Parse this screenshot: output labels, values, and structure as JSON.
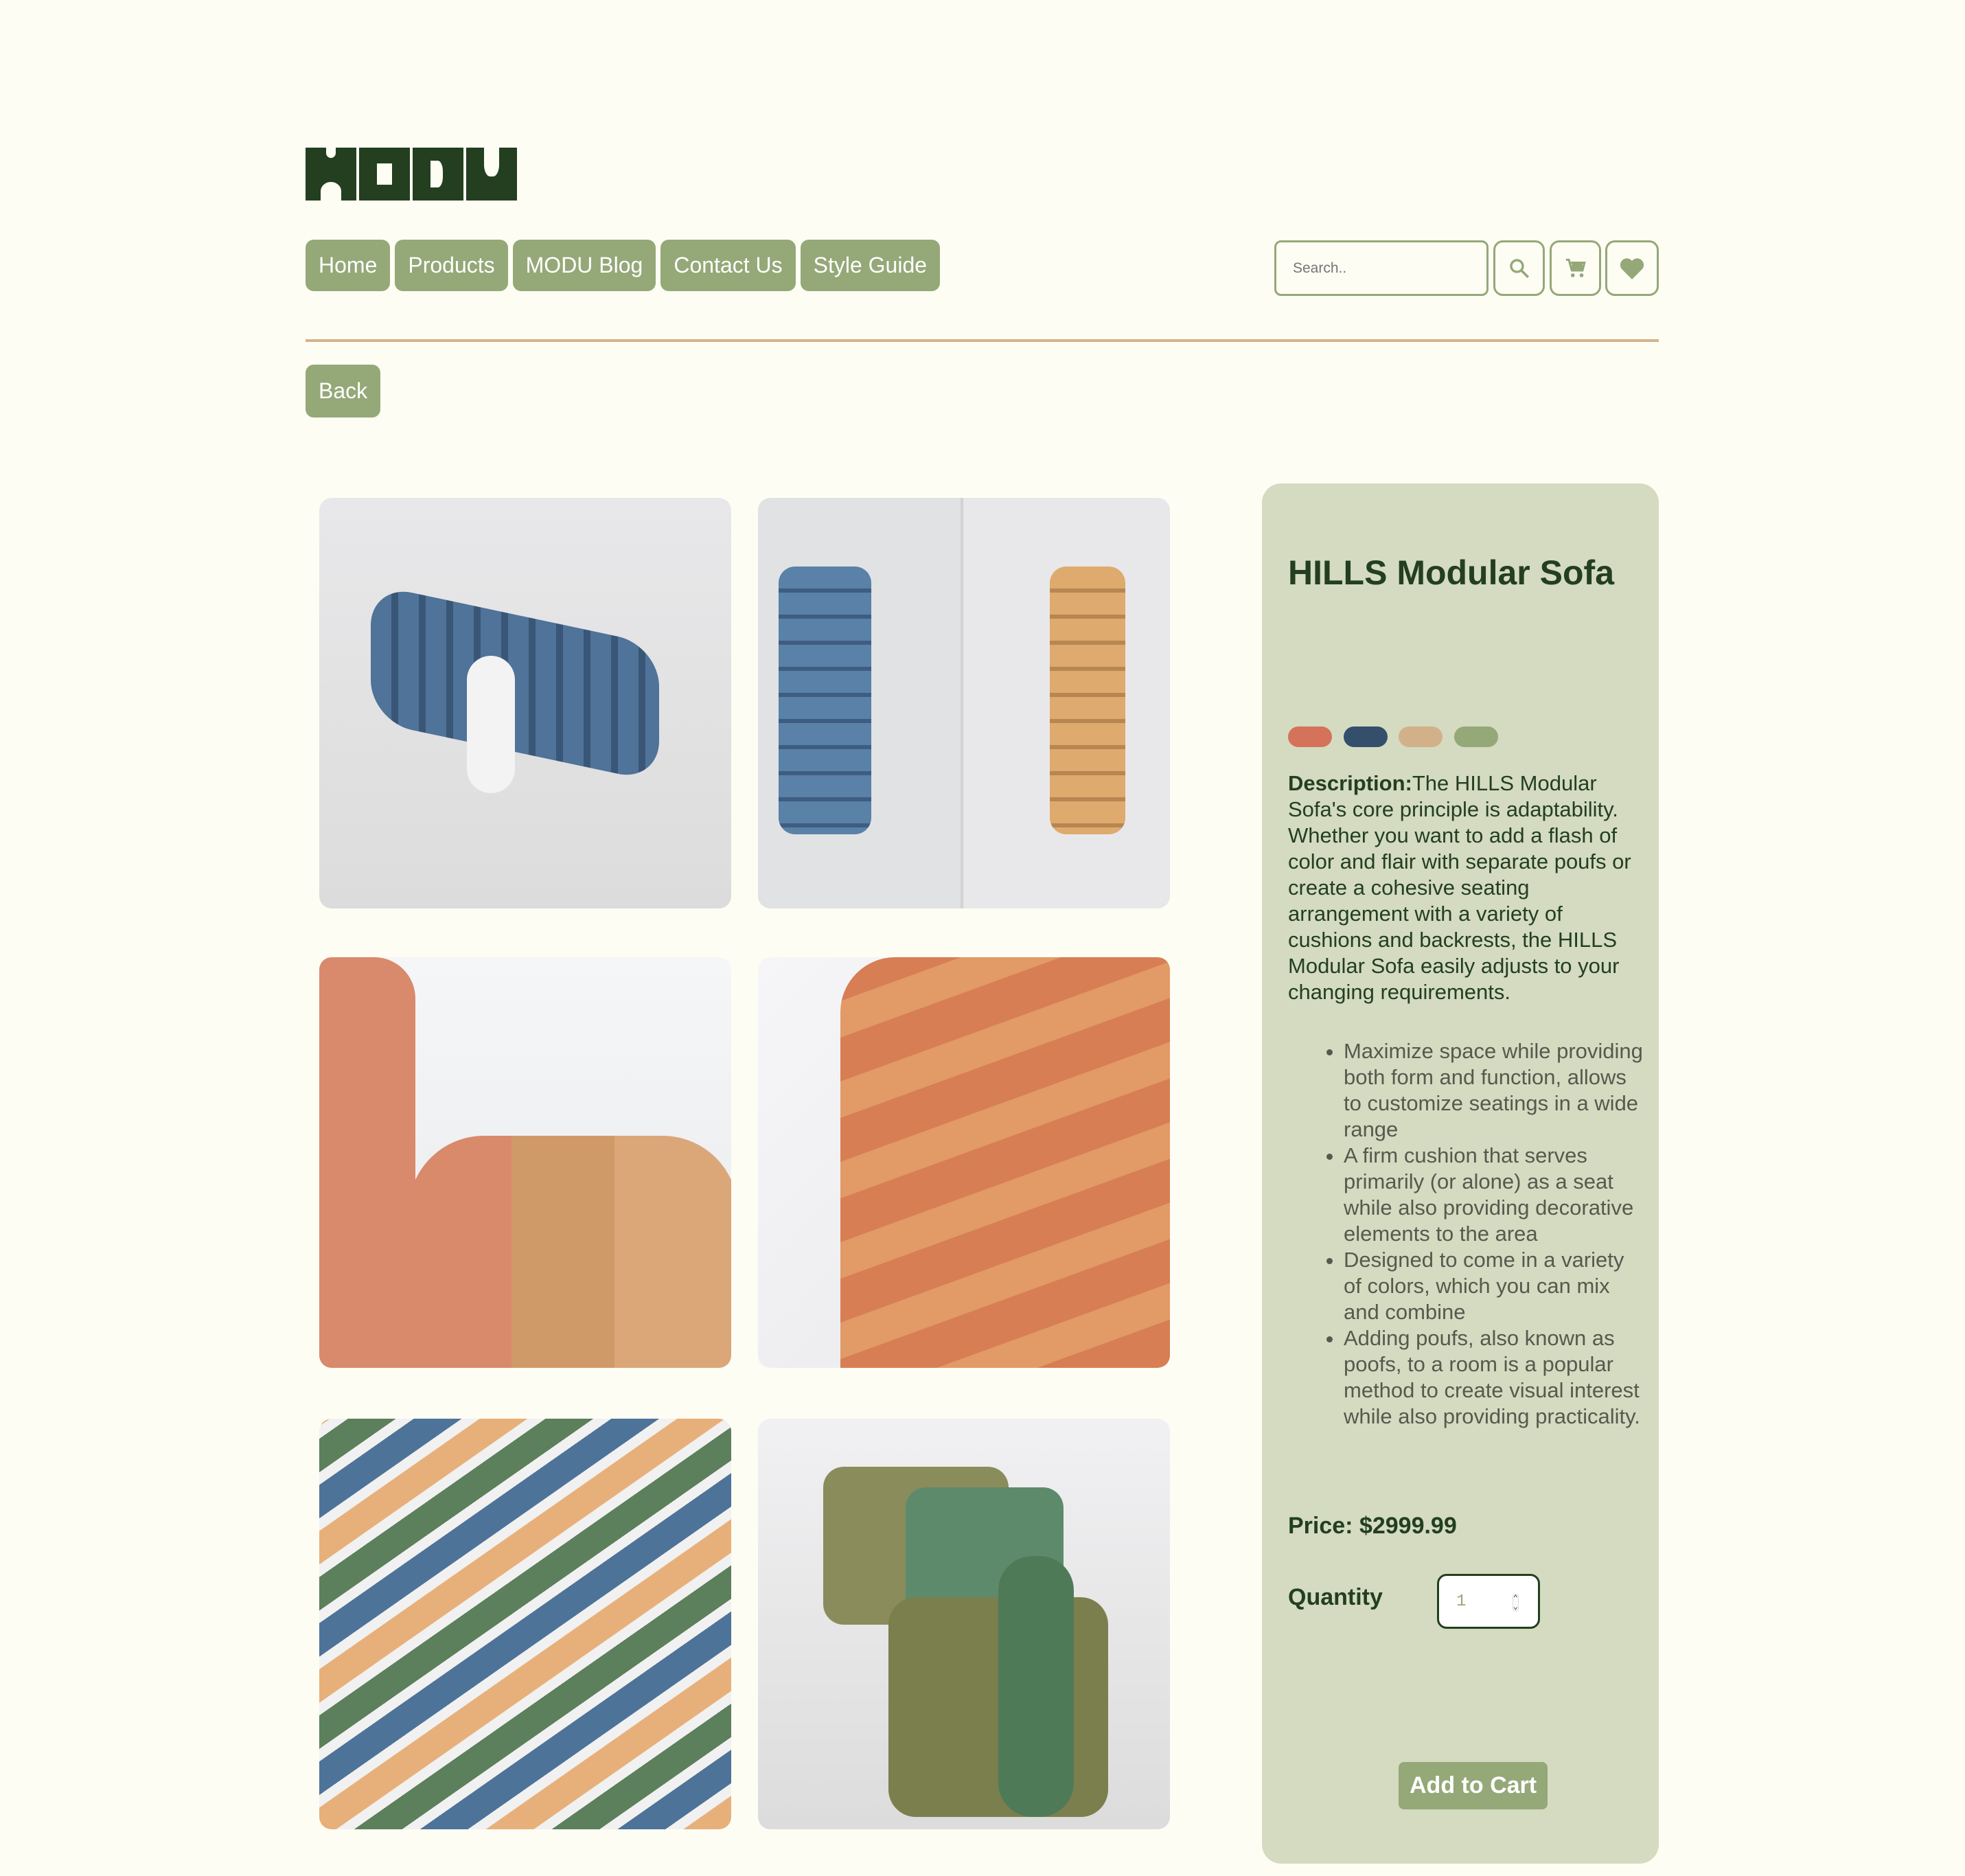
{
  "brand": {
    "logo_text": "MODU"
  },
  "nav": {
    "items": [
      "Home",
      "Products",
      "MODU Blog",
      "Contact Us",
      "Style Guide"
    ]
  },
  "search": {
    "placeholder": "Search.."
  },
  "icons": {
    "search": "search-icon",
    "cart": "cart-icon",
    "wishlist": "heart-icon"
  },
  "back_label": "Back",
  "product": {
    "title": "HILLS Modular Sofa",
    "colors": [
      "#d4735a",
      "#334f6c",
      "#d2b18a",
      "#95a878"
    ],
    "description_label": "Description:",
    "description": "The HILLS Modular Sofa's core principle is adaptability. Whether you want to add a flash of color and flair with separate poufs or create a cohesive seating arrangement with a variety of cushions and backrests, the HILLS Modular Sofa easily adjusts to your changing requirements.",
    "features": [
      "Maximize space while providing both form and function, allows to customize seatings in a wide range",
      "A firm cushion that serves primarily (or alone) as a seat while also providing decorative elements to the area",
      "Designed to come in a variety of colors, which you can mix and combine",
      "Adding poufs, also known as poofs, to a room is a popular method to create visual interest while also providing practicality."
    ],
    "price": "Price: $2999.99",
    "quantity_label": "Quantity",
    "quantity": "1",
    "add_to_cart": "Add to Cart"
  }
}
